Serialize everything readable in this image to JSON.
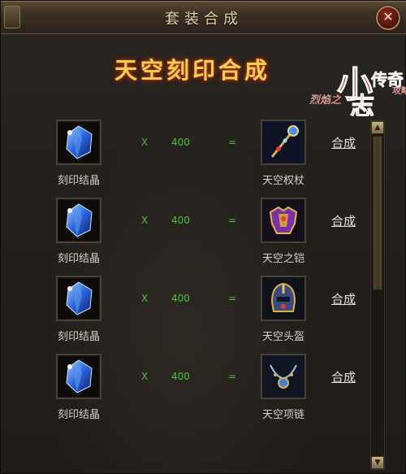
{
  "window": {
    "title": "套装合成",
    "close_icon": "close-icon"
  },
  "banner": {
    "title": "天空刻印合成",
    "logo_text": "烈焰之小志传奇攻略"
  },
  "recipes": [
    {
      "material": "刻印结晶",
      "material_icon": "blue-crystal-icon",
      "operator": "X",
      "quantity": "400",
      "equals": "=",
      "result": "天空权杖",
      "result_icon": "scepter-icon",
      "action": "合成"
    },
    {
      "material": "刻印结晶",
      "material_icon": "blue-crystal-icon",
      "operator": "X",
      "quantity": "400",
      "equals": "=",
      "result": "天空之铠",
      "result_icon": "armor-icon",
      "action": "合成"
    },
    {
      "material": "刻印结晶",
      "material_icon": "blue-crystal-icon",
      "operator": "X",
      "quantity": "400",
      "equals": "=",
      "result": "天空头盔",
      "result_icon": "helmet-icon",
      "action": "合成"
    },
    {
      "material": "刻印结晶",
      "material_icon": "blue-crystal-icon",
      "operator": "X",
      "quantity": "400",
      "equals": "=",
      "result": "天空项链",
      "result_icon": "necklace-icon",
      "action": "合成"
    }
  ],
  "colors": {
    "accent_green": "#4ac23a",
    "title_gold": "#f4cf55"
  }
}
